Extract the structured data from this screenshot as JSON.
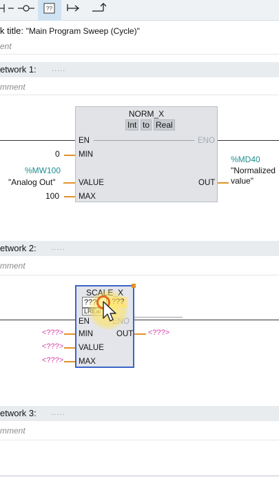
{
  "toolbar": {
    "buttons": [
      {
        "icon": "contact-icon"
      },
      {
        "icon": "coil-icon"
      },
      {
        "icon": "empty-box-icon",
        "active": true
      },
      {
        "icon": "open-branch-icon"
      },
      {
        "icon": "close-branch-icon"
      }
    ]
  },
  "block": {
    "title_label": "k title:",
    "title_value": "\"Main Program Sweep (Cycle)\"",
    "comment": "ent"
  },
  "networks": [
    {
      "title": "etwork 1:",
      "dots": ".....",
      "comment": "mment"
    },
    {
      "title": "etwork 2:",
      "dots": ".....",
      "comment": "mment"
    },
    {
      "title": "etwork 3:",
      "dots": ".....",
      "comment": "mment"
    }
  ],
  "norm_x": {
    "name": "NORM_X",
    "type_from": "Int",
    "type_to_word": "to",
    "type_to": "Real",
    "pins": {
      "en": "EN",
      "eno": "ENO",
      "min": "MIN",
      "value": "VALUE",
      "max": "MAX",
      "out": "OUT"
    },
    "operands": {
      "min": "0",
      "value_addr": "%MW100",
      "value_name": "\"Analog Out\"",
      "max": "100",
      "out_addr": "%MD40",
      "out_name_1": "\"Normalized",
      "out_name_2": "value\""
    }
  },
  "scale_x": {
    "name": "SCALE_X",
    "type_from": "???",
    "type_to": "???",
    "dropdown_item": "LREal",
    "pins": {
      "en": "EN",
      "eno": "ENO",
      "min": "MIN",
      "value": "VALUE",
      "max": "MAX",
      "out": "OUT"
    },
    "operands": {
      "min": "<???>",
      "value": "<???>",
      "max": "<???>",
      "out": "<???>"
    }
  },
  "colors": {
    "address": "#1e8e8e",
    "placeholder": "#d63fa8",
    "wire_highlight": "#e0922a",
    "selection": "#3a64c8"
  }
}
